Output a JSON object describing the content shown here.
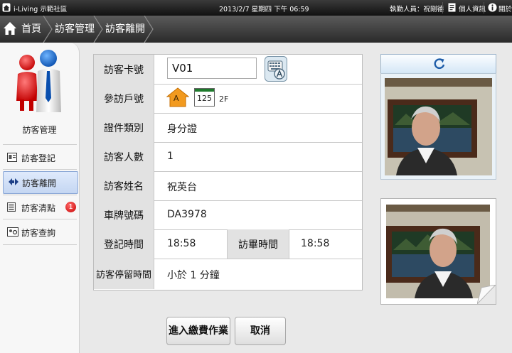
{
  "topbar": {
    "brand": "i-Living 示範社區",
    "datetime": "2013/2/7 星期四 下午 06:59",
    "duty_staff": "執勤人員：祝剛德",
    "personal_info": "個人資訊",
    "about": "關於"
  },
  "nav": {
    "home": "首頁",
    "crumb1": "訪客管理",
    "crumb2": "訪客離開"
  },
  "sidebar": {
    "title": "訪客管理",
    "items": [
      {
        "label": "訪客登記",
        "icon": "register-icon"
      },
      {
        "label": "訪客離開",
        "icon": "leave-arrow-icon"
      },
      {
        "label": "訪客清點",
        "icon": "list-icon",
        "badge": "1"
      },
      {
        "label": "訪客查詢",
        "icon": "search-person-icon"
      }
    ]
  },
  "form": {
    "card_no_label": "訪客卡號",
    "card_no_value": "V01",
    "unit_label": "參訪戶號",
    "unit_building": "A",
    "unit_number": "125",
    "unit_floor": "2F",
    "id_type_label": "證件類別",
    "id_type_value": "身分證",
    "visitors_label": "訪客人數",
    "visitors_value": "1",
    "name_label": "訪客姓名",
    "name_value": "祝英台",
    "plate_label": "車牌號碼",
    "plate_value": "DA3978",
    "checkin_label": "登記時間",
    "checkin_value": "18:58",
    "checkout_label": "訪畢時間",
    "checkout_value": "18:58",
    "stay_label": "訪客停留時間",
    "stay_value": "小於 1 分鐘"
  },
  "buttons": {
    "payment": "進入繳費作業",
    "cancel": "取消"
  },
  "colors": {
    "active_menu": "#c4d6f2",
    "badge": "#c70000",
    "label_bg": "#e2e2e2",
    "building_tag": "#f29a1f"
  }
}
